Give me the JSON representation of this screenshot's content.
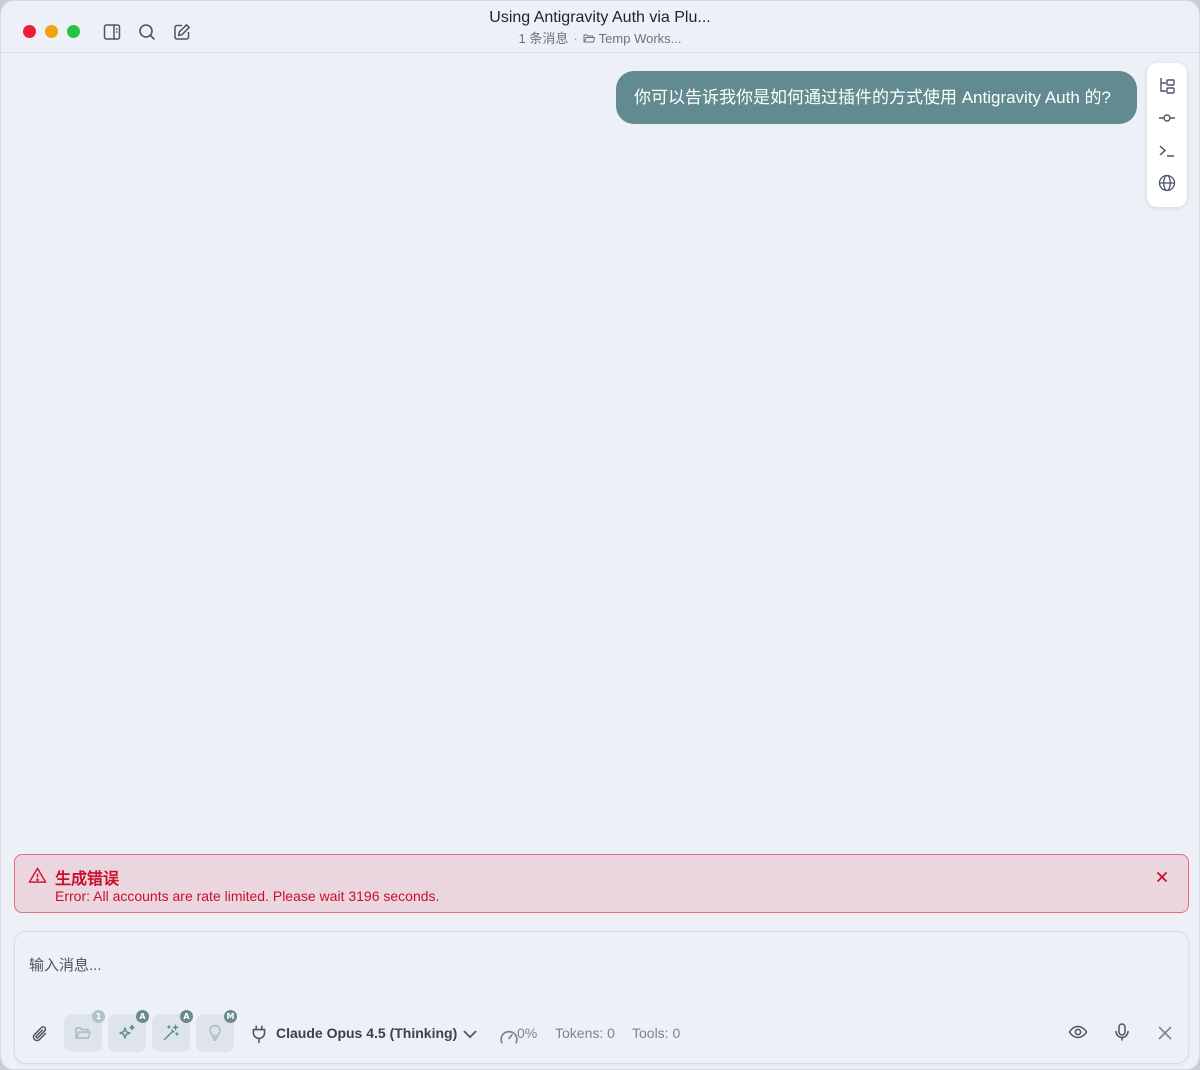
{
  "window": {
    "title": "Using Antigravity Auth via Plu...",
    "message_count": "1 条消息",
    "separator": "·",
    "workspace": "Temp Works..."
  },
  "icons": {
    "sidebar_toggle": "sidebar-icon",
    "search": "search-icon",
    "new_chat": "edit-icon",
    "side_tools": [
      "file-tree-icon",
      "commit-icon",
      "terminal-icon",
      "globe-icon"
    ]
  },
  "conversation": {
    "messages": [
      {
        "role": "user",
        "text": "你可以告诉我你是如何通过插件的方式使用  Antigravity Auth 的?"
      }
    ]
  },
  "error": {
    "title": "生成错误",
    "message": "Error: All accounts are rate limited. Please wait 3196 seconds."
  },
  "composer": {
    "placeholder": "输入消息...",
    "value": "",
    "mode_buttons": [
      {
        "name": "folder",
        "badge": "1"
      },
      {
        "name": "sparkles",
        "badge": "A"
      },
      {
        "name": "magic-wand",
        "badge": "A"
      },
      {
        "name": "lightbulb",
        "badge": "M"
      }
    ],
    "model": "Claude Opus 4.5 (Thinking)",
    "context_usage": "0%",
    "tokens": "Tokens: 0",
    "tools": "Tools: 0"
  },
  "colors": {
    "background": "#edf1f7",
    "bubble": "#618b90",
    "error_text": "#c8102e",
    "error_bg": "#ebd5de",
    "accent": "#5f8990"
  }
}
